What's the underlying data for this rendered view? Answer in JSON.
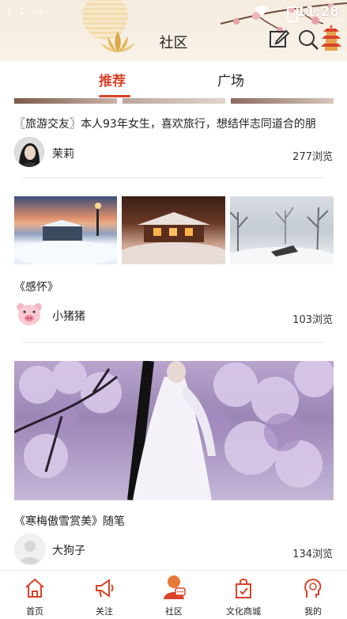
{
  "status_bar": {
    "time": "11:28"
  },
  "header": {
    "title": "社区"
  },
  "tabs": [
    {
      "label": "推荐",
      "active": true
    },
    {
      "label": "广场",
      "active": false
    }
  ],
  "posts": [
    {
      "title": "〖旅游交友〗本人93年女生，喜欢旅行，想结伴志同道合的朋",
      "author": "茉莉",
      "views": "277浏览"
    },
    {
      "title": "《感怀》",
      "author": "小猪猪",
      "views": "103浏览"
    },
    {
      "title": "《寒梅傲雪赏美》随笔",
      "author": "大狗子",
      "views": "134浏览"
    }
  ],
  "bottom_nav": [
    {
      "label": "首页",
      "icon": "home-icon"
    },
    {
      "label": "关注",
      "icon": "megaphone-icon"
    },
    {
      "label": "社区",
      "icon": "community-icon",
      "active": true
    },
    {
      "label": "文化商城",
      "icon": "shopping-bag-icon"
    },
    {
      "label": "我的",
      "icon": "profile-icon"
    }
  ],
  "colors": {
    "accent": "#d9432a",
    "header_bg": "#f5ecdf"
  }
}
